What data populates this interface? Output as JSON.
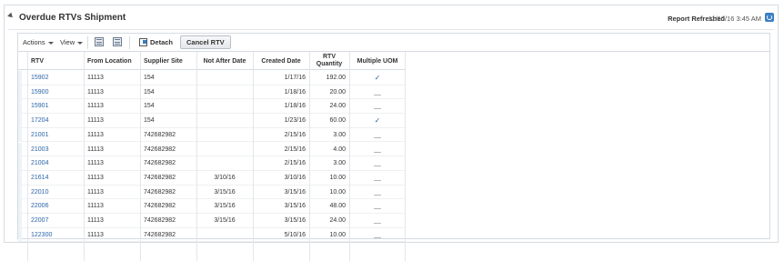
{
  "panel": {
    "title": "Overdue RTVs Shipment",
    "refresh_label": "Report Refreshed",
    "refresh_time": "11/10/16 3:45 AM"
  },
  "toolbar": {
    "actions_label": "Actions",
    "view_label": "View",
    "detach_label": "Detach",
    "cancel_rtv_label": "Cancel RTV"
  },
  "table": {
    "columns": [
      "RTV",
      "From Location",
      "Supplier Site",
      "Not After Date",
      "Created Date",
      "RTV Quantity",
      "Multiple UOM"
    ],
    "rows": [
      {
        "rtv": "15902",
        "from": "11113",
        "site": "154",
        "not_after": "",
        "created": "1/17/16",
        "qty": "192.00",
        "multi": "✓"
      },
      {
        "rtv": "15900",
        "from": "11113",
        "site": "154",
        "not_after": "",
        "created": "1/18/16",
        "qty": "20.00",
        "multi": "__"
      },
      {
        "rtv": "15901",
        "from": "11113",
        "site": "154",
        "not_after": "",
        "created": "1/18/16",
        "qty": "24.00",
        "multi": "__"
      },
      {
        "rtv": "17204",
        "from": "11113",
        "site": "154",
        "not_after": "",
        "created": "1/23/16",
        "qty": "60.00",
        "multi": "✓"
      },
      {
        "rtv": "21001",
        "from": "11113",
        "site": "742682982",
        "not_after": "",
        "created": "2/15/16",
        "qty": "3.00",
        "multi": "__"
      },
      {
        "rtv": "21003",
        "from": "11113",
        "site": "742682982",
        "not_after": "",
        "created": "2/15/16",
        "qty": "4.00",
        "multi": "__"
      },
      {
        "rtv": "21004",
        "from": "11113",
        "site": "742682982",
        "not_after": "",
        "created": "2/15/16",
        "qty": "3.00",
        "multi": "__"
      },
      {
        "rtv": "21614",
        "from": "11113",
        "site": "742682982",
        "not_after": "3/10/16",
        "created": "3/10/16",
        "qty": "10.00",
        "multi": "__"
      },
      {
        "rtv": "22010",
        "from": "11113",
        "site": "742682982",
        "not_after": "3/15/16",
        "created": "3/15/16",
        "qty": "10.00",
        "multi": "__"
      },
      {
        "rtv": "22006",
        "from": "11113",
        "site": "742682982",
        "not_after": "3/15/16",
        "created": "3/15/16",
        "qty": "48.00",
        "multi": "__"
      },
      {
        "rtv": "22007",
        "from": "11113",
        "site": "742682982",
        "not_after": "3/15/16",
        "created": "3/15/16",
        "qty": "24.00",
        "multi": "__"
      },
      {
        "rtv": "122300",
        "from": "11113",
        "site": "742682982",
        "not_after": "",
        "created": "5/10/16",
        "qty": "10.00",
        "multi": "__"
      }
    ]
  },
  "icons": {
    "collapse": "triangle-collapse-icon",
    "refresh": "refresh-icon",
    "export": "export-icon",
    "print": "print-icon",
    "detach": "detach-icon"
  }
}
